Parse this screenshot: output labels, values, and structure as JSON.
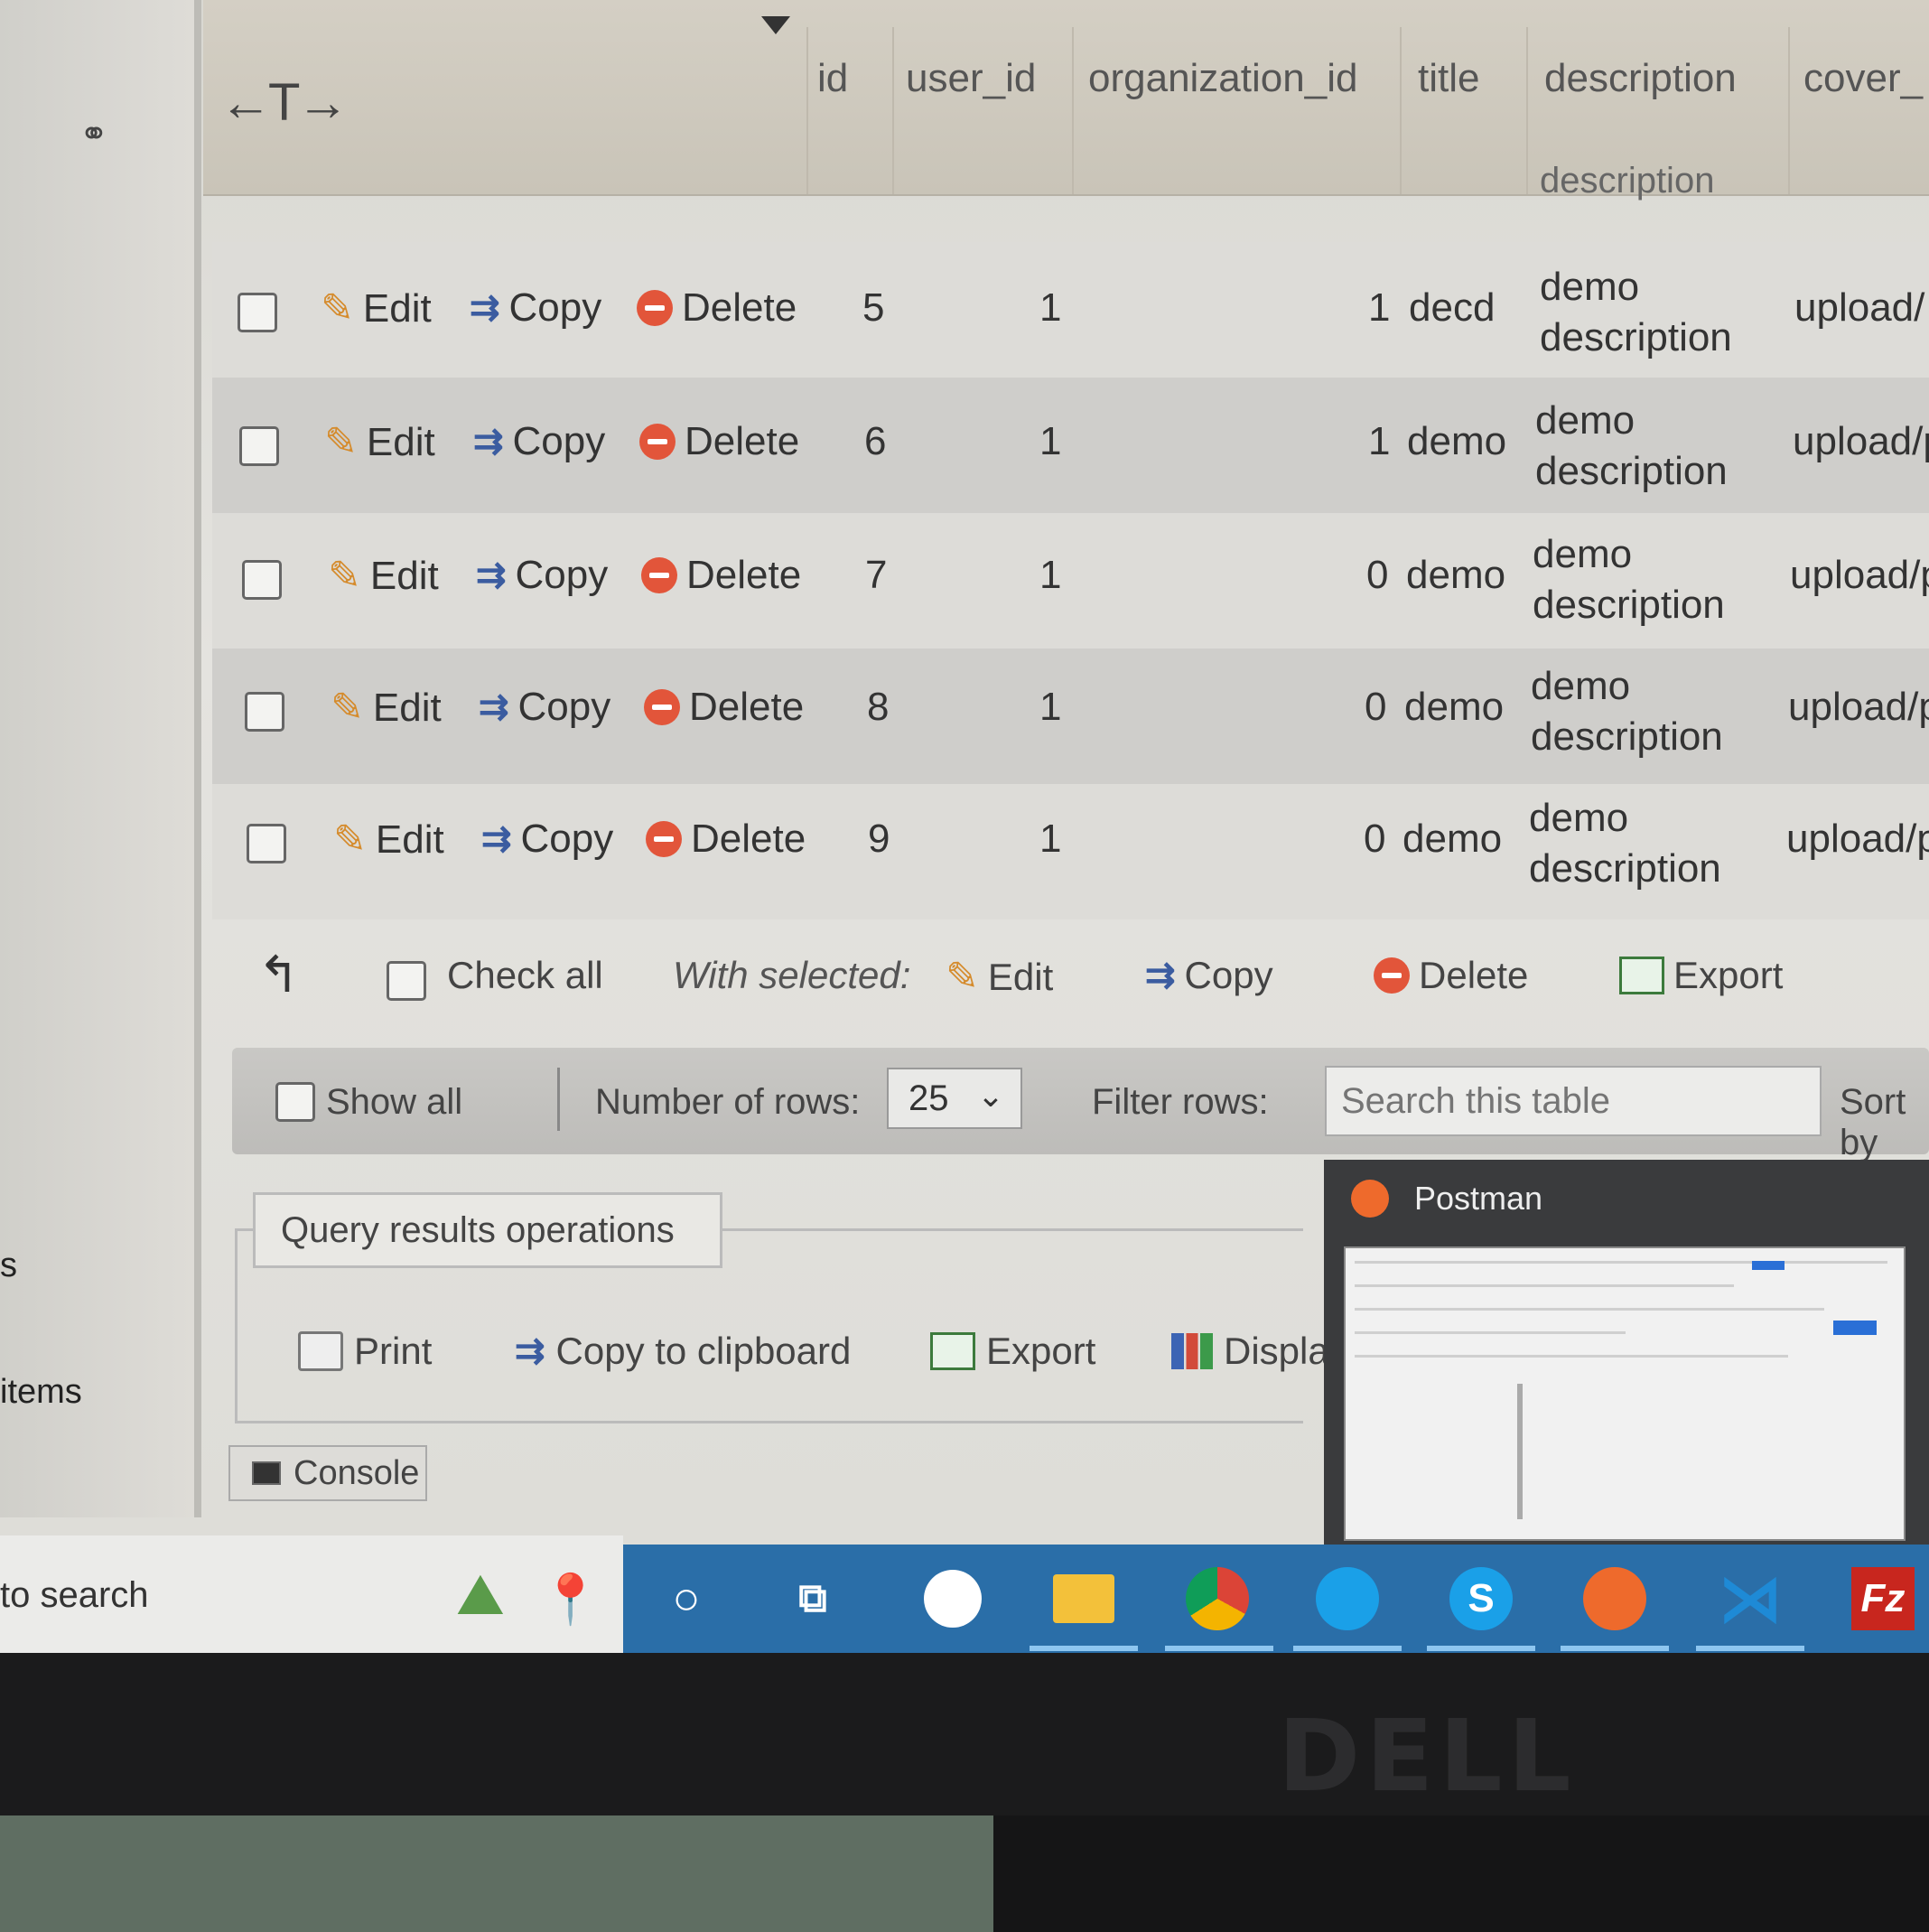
{
  "table": {
    "columns": [
      "id",
      "user_id",
      "organization_id",
      "title",
      "description",
      "cover_"
    ],
    "header_sub": "description",
    "rows": [
      {
        "id": "5",
        "user_id": "1",
        "organization_id": "1",
        "title": "decd",
        "description_line1": "demo",
        "description_line2": "description",
        "cover": "upload/"
      },
      {
        "id": "6",
        "user_id": "1",
        "organization_id": "1",
        "title": "demo",
        "description_line1": "demo",
        "description_line2": "description",
        "cover": "upload/p"
      },
      {
        "id": "7",
        "user_id": "1",
        "organization_id": "0",
        "title": "demo",
        "description_line1": "demo",
        "description_line2": "description",
        "cover": "upload/p"
      },
      {
        "id": "8",
        "user_id": "1",
        "organization_id": "0",
        "title": "demo",
        "description_line1": "demo",
        "description_line2": "description",
        "cover": "upload/p"
      },
      {
        "id": "9",
        "user_id": "1",
        "organization_id": "0",
        "title": "demo",
        "description_line1": "demo",
        "description_line2": "description",
        "cover": "upload/p"
      }
    ],
    "row_actions": {
      "edit": "Edit",
      "copy": "Copy",
      "delete": "Delete"
    }
  },
  "bulk": {
    "check_all": "Check all",
    "with_selected": "With selected:",
    "edit": "Edit",
    "copy": "Copy",
    "delete": "Delete",
    "export": "Export"
  },
  "nav": {
    "show_all": "Show all",
    "number_of_rows_label": "Number of rows:",
    "number_of_rows_value": "25",
    "filter_rows_label": "Filter rows:",
    "filter_placeholder": "Search this table",
    "sort_by": "Sort by"
  },
  "query_ops": {
    "legend": "Query results operations",
    "print": "Print",
    "copy_to_clipboard": "Copy to clipboard",
    "export": "Export",
    "display": "Displa"
  },
  "console": "Console",
  "left_panel": {
    "items": "items",
    "s": "s"
  },
  "postman_preview": {
    "title": "Postman"
  },
  "taskbar": {
    "search_text": "to search"
  },
  "monitor_brand": "DELL",
  "colors": {
    "delete_red": "#e2553a",
    "edit_orange": "#d58b2c",
    "taskbar_blue": "#2a6ea8",
    "postman_orange": "#ee6a2c"
  }
}
